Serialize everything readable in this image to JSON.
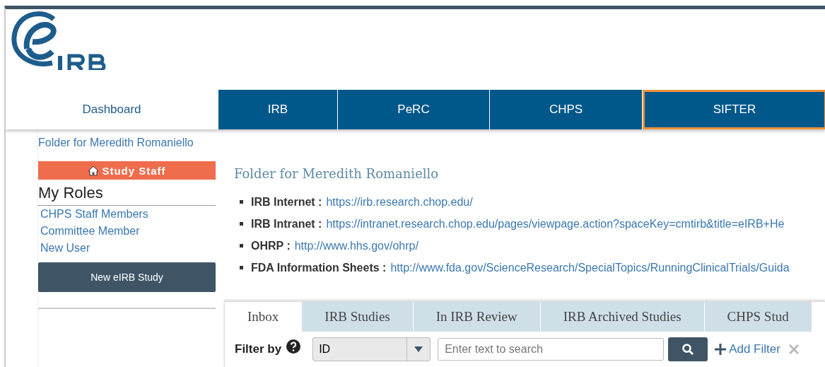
{
  "nav": [
    {
      "label": "Dashboard",
      "selected": true,
      "highlighted": false
    },
    {
      "label": "IRB",
      "selected": false,
      "highlighted": false
    },
    {
      "label": "PeRC",
      "selected": false,
      "highlighted": false
    },
    {
      "label": "CHPS",
      "selected": false,
      "highlighted": false
    },
    {
      "label": "SIFTER",
      "selected": false,
      "highlighted": true
    }
  ],
  "sidebar": {
    "folder_link": "Folder for Meredith Romaniello",
    "role_banner": "Study Staff",
    "roles_heading": "My Roles",
    "roles": [
      "CHPS Staff Members",
      "Committee Member",
      "New User"
    ],
    "new_study_button": "New eIRB Study"
  },
  "main": {
    "title": "Folder for Meredith Romaniello",
    "links": [
      {
        "label": "IRB Internet :",
        "url": "https://irb.research.chop.edu/"
      },
      {
        "label": "IRB Intranet :",
        "url": "https://intranet.research.chop.edu/pages/viewpage.action?spaceKey=cmtirb&title=eIRB+He"
      },
      {
        "label": "OHRP :",
        "url": "http://www.hhs.gov/ohrp/"
      },
      {
        "label": "FDA Information Sheets :",
        "url": "http://www.fda.gov/ScienceResearch/SpecialTopics/RunningClinicalTrials/Guida"
      }
    ],
    "tabs": [
      {
        "label": "Inbox",
        "selected": true
      },
      {
        "label": "IRB Studies",
        "selected": false
      },
      {
        "label": "In IRB Review",
        "selected": false
      },
      {
        "label": "IRB Archived Studies",
        "selected": false
      },
      {
        "label": "CHPS Stud",
        "selected": false
      }
    ],
    "filter": {
      "label": "Filter by",
      "field": "ID",
      "placeholder": "Enter text to search",
      "add_filter": "Add Filter"
    }
  }
}
